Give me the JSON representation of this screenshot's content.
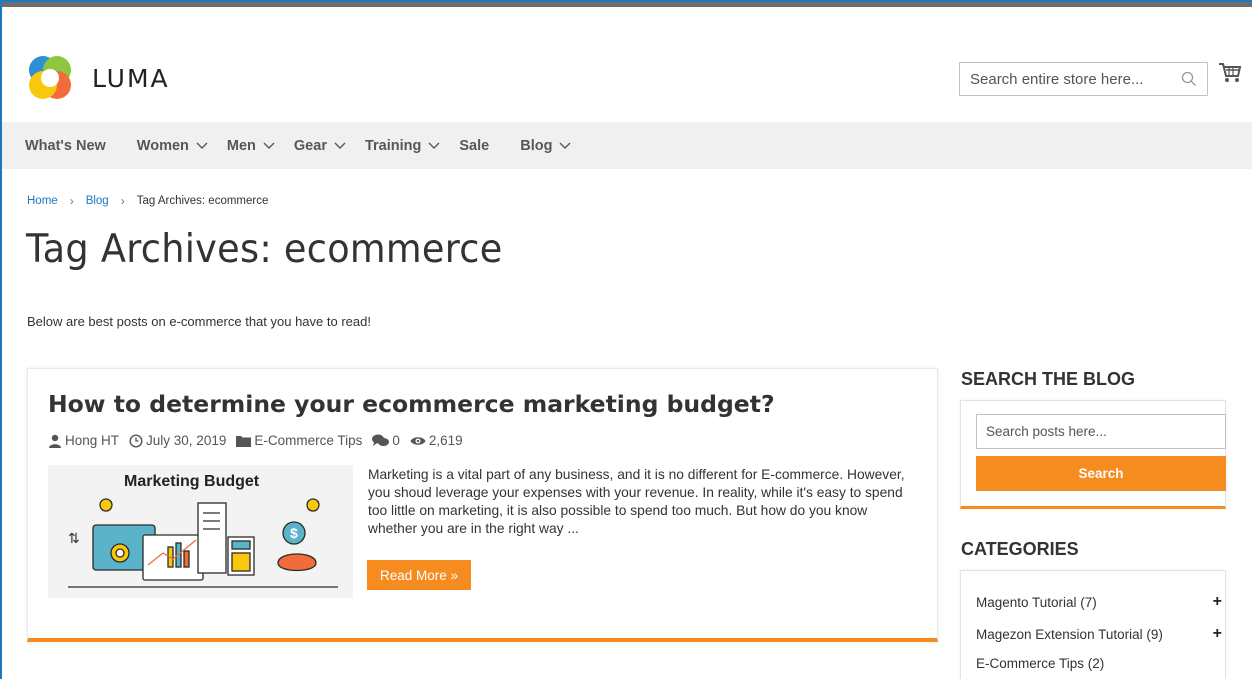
{
  "header": {
    "logo_text": "LUMA",
    "search_placeholder": "Search entire store here...",
    "colors": {
      "brand_orange": "#f68b1f",
      "link_blue": "#1979c3",
      "nav_bg": "#f0f0f0"
    }
  },
  "nav": {
    "items": [
      {
        "label": "What's New",
        "has_dropdown": false
      },
      {
        "label": "Women",
        "has_dropdown": true
      },
      {
        "label": "Men",
        "has_dropdown": true
      },
      {
        "label": "Gear",
        "has_dropdown": true
      },
      {
        "label": "Training",
        "has_dropdown": true
      },
      {
        "label": "Sale",
        "has_dropdown": false
      },
      {
        "label": "Blog",
        "has_dropdown": true
      }
    ]
  },
  "breadcrumbs": {
    "home": "Home",
    "blog": "Blog",
    "current": "Tag Archives: ecommerce"
  },
  "page": {
    "title": "Tag Archives: ecommerce",
    "intro": "Below are best posts on e-commerce that you have to read!"
  },
  "post": {
    "title": "How to determine your ecommerce marketing budget?",
    "author": "Hong HT",
    "date": "July 30, 2019",
    "category": "E-Commerce Tips",
    "comments": "0",
    "views": "2,619",
    "thumbnail_title": "Marketing Budget",
    "excerpt": "Marketing is a vital part of any business, and it is no different for E-commerce. However, you shoud leverage your expenses with your revenue. In reality, while it's easy to spend too little on marketing, it is also possible to spend too much. But how do you know whether you are in the right way ...",
    "read_more": "Read More »"
  },
  "sidebar": {
    "search_heading": "SEARCH THE BLOG",
    "search_placeholder": "Search posts here...",
    "search_button": "Search",
    "categories_heading": "CATEGORIES",
    "categories": [
      {
        "label": "Magento Tutorial (7)",
        "expandable": true
      },
      {
        "label": "Magezon Extension Tutorial (9)",
        "expandable": true
      },
      {
        "label": "E-Commerce Tips (2)",
        "expandable": false
      }
    ]
  }
}
